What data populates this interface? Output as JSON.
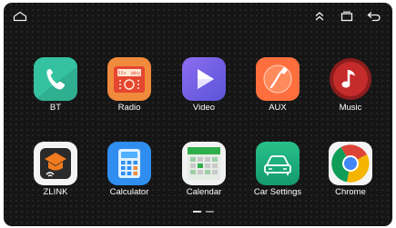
{
  "apps": [
    {
      "label": "BT",
      "icon": "phone-icon"
    },
    {
      "label": "Radio",
      "icon": "radio-icon"
    },
    {
      "label": "Video",
      "icon": "play-icon"
    },
    {
      "label": "AUX",
      "icon": "aux-cable-icon"
    },
    {
      "label": "Music",
      "icon": "music-note-icon"
    },
    {
      "label": "ZLINK",
      "icon": "zlink-icon"
    },
    {
      "label": "Calculator",
      "icon": "calculator-icon"
    },
    {
      "label": "Calendar",
      "icon": "calendar-icon"
    },
    {
      "label": "Car Settings",
      "icon": "car-icon"
    },
    {
      "label": "Chrome",
      "icon": "chrome-icon"
    }
  ],
  "radio_icon_text": "MHz",
  "page_indicator": {
    "current": 1,
    "total": 2
  },
  "colors": {
    "background": "#151515",
    "bt": "#35c2a0",
    "radio": "#f08a3c",
    "video": "#7a62e6",
    "aux": "#ff6f3e",
    "music": "#c52b2b",
    "zlink": "#f07a1e",
    "calculator": "#2f8ef0",
    "calendar": "#2fae4c",
    "car_settings": "#1fab7c"
  }
}
